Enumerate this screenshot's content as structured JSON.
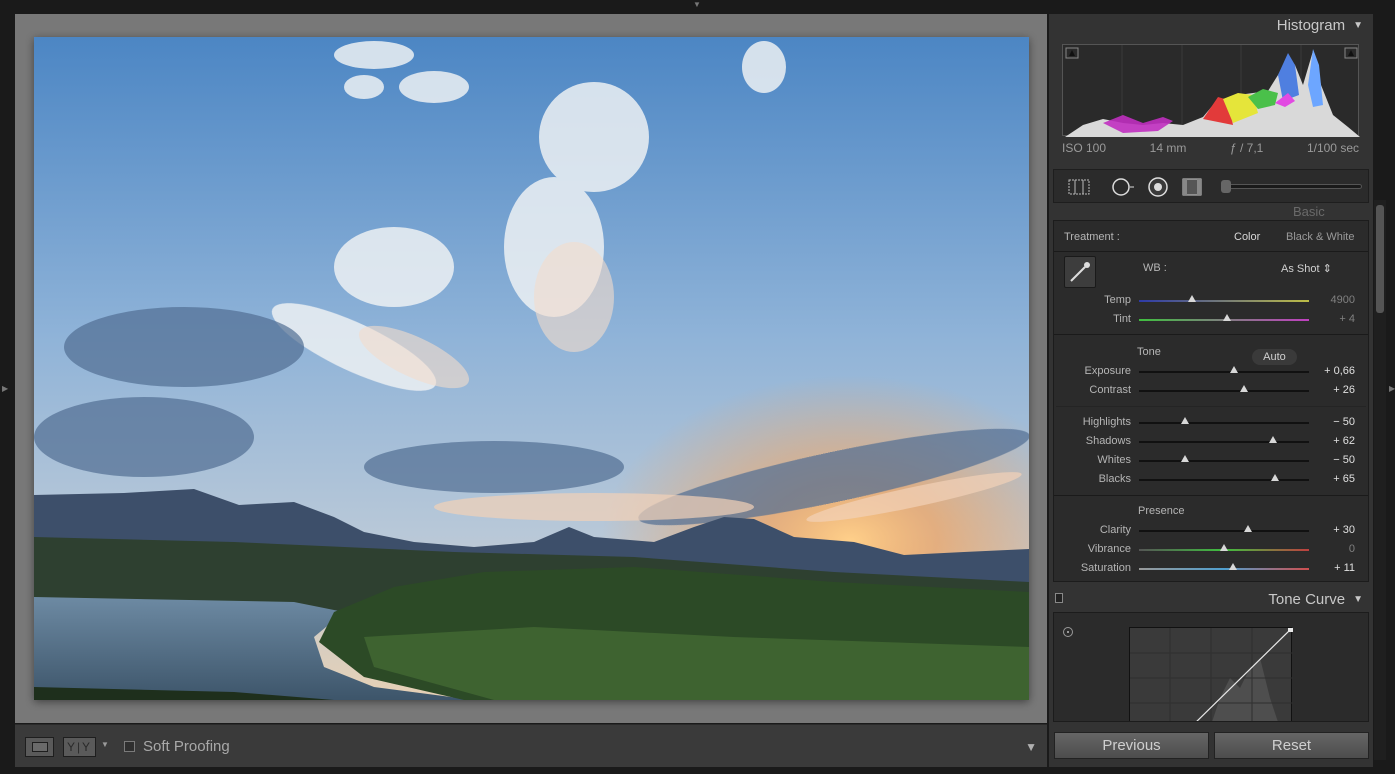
{
  "viewer": {
    "soft_proofing_label": "Soft Proofing",
    "compare_icon_label": "Y|Y"
  },
  "histogram": {
    "title": "Histogram",
    "iso": "ISO 100",
    "focal": "14 mm",
    "aperture": "ƒ / 7,1",
    "shutter": "1/100 sec"
  },
  "basic": {
    "peek_title": "Basic",
    "treatment_label": "Treatment :",
    "treatment_color": "Color",
    "treatment_bw": "Black & White",
    "wb_label": "WB :",
    "wb_value": "As Shot ⇕",
    "tone_title": "Tone",
    "auto_label": "Auto",
    "presence_title": "Presence",
    "sliders": {
      "temp": {
        "label": "Temp",
        "value": "4900",
        "position": 0.31
      },
      "tint": {
        "label": "Tint",
        "value": "+ 4",
        "position": 0.52
      },
      "exposure": {
        "label": "Exposure",
        "value": "+ 0,66",
        "position": 0.56
      },
      "contrast": {
        "label": "Contrast",
        "value": "+ 26",
        "position": 0.62
      },
      "highlights": {
        "label": "Highlights",
        "value": "− 50",
        "position": 0.27
      },
      "shadows": {
        "label": "Shadows",
        "value": "+ 62",
        "position": 0.79
      },
      "whites": {
        "label": "Whites",
        "value": "− 50",
        "position": 0.27
      },
      "blacks": {
        "label": "Blacks",
        "value": "+ 65",
        "position": 0.8
      },
      "clarity": {
        "label": "Clarity",
        "value": "+ 30",
        "position": 0.64
      },
      "vibrance": {
        "label": "Vibrance",
        "value": "0",
        "position": 0.5
      },
      "saturation": {
        "label": "Saturation",
        "value": "+ 11",
        "position": 0.55
      }
    }
  },
  "tone_curve": {
    "title": "Tone Curve"
  },
  "buttons": {
    "previous": "Previous",
    "reset": "Reset"
  }
}
